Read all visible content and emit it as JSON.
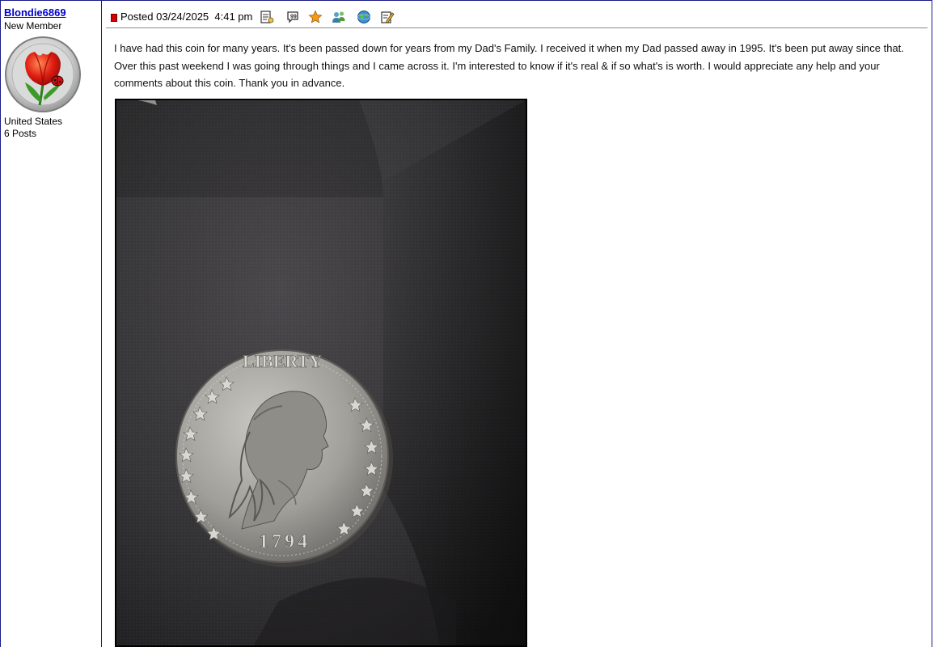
{
  "author": {
    "name": "Blondie6869",
    "title": "New Member",
    "avatar_icon": "tulip-ladybug-coin-avatar",
    "country": "United States",
    "posts": "6 Posts"
  },
  "post": {
    "posted": "Posted 03/24/2025  4:41 pm",
    "header_icons": [
      "profile-icon",
      "quote-icon",
      "favorite-star-icon",
      "members-icon",
      "web-globe-icon",
      "edit-icon"
    ],
    "body": "I have had this coin for many years. It's been passed down for years from my Dad's Family. I received it when my Dad passed away in 1995. It's been put away since that. Over this past weekend I was going through things and I came across it. I'm interested to know if it's real & if so what's is worth. I would appreciate any help and your comments about this coin. Thank you in advance.",
    "photo": {
      "coin_legend": "LIBERTY",
      "coin_date": "1794"
    }
  },
  "colors": {
    "border": "#1a1a8a",
    "link": "#0000cc",
    "post_marker": "#d40000"
  }
}
